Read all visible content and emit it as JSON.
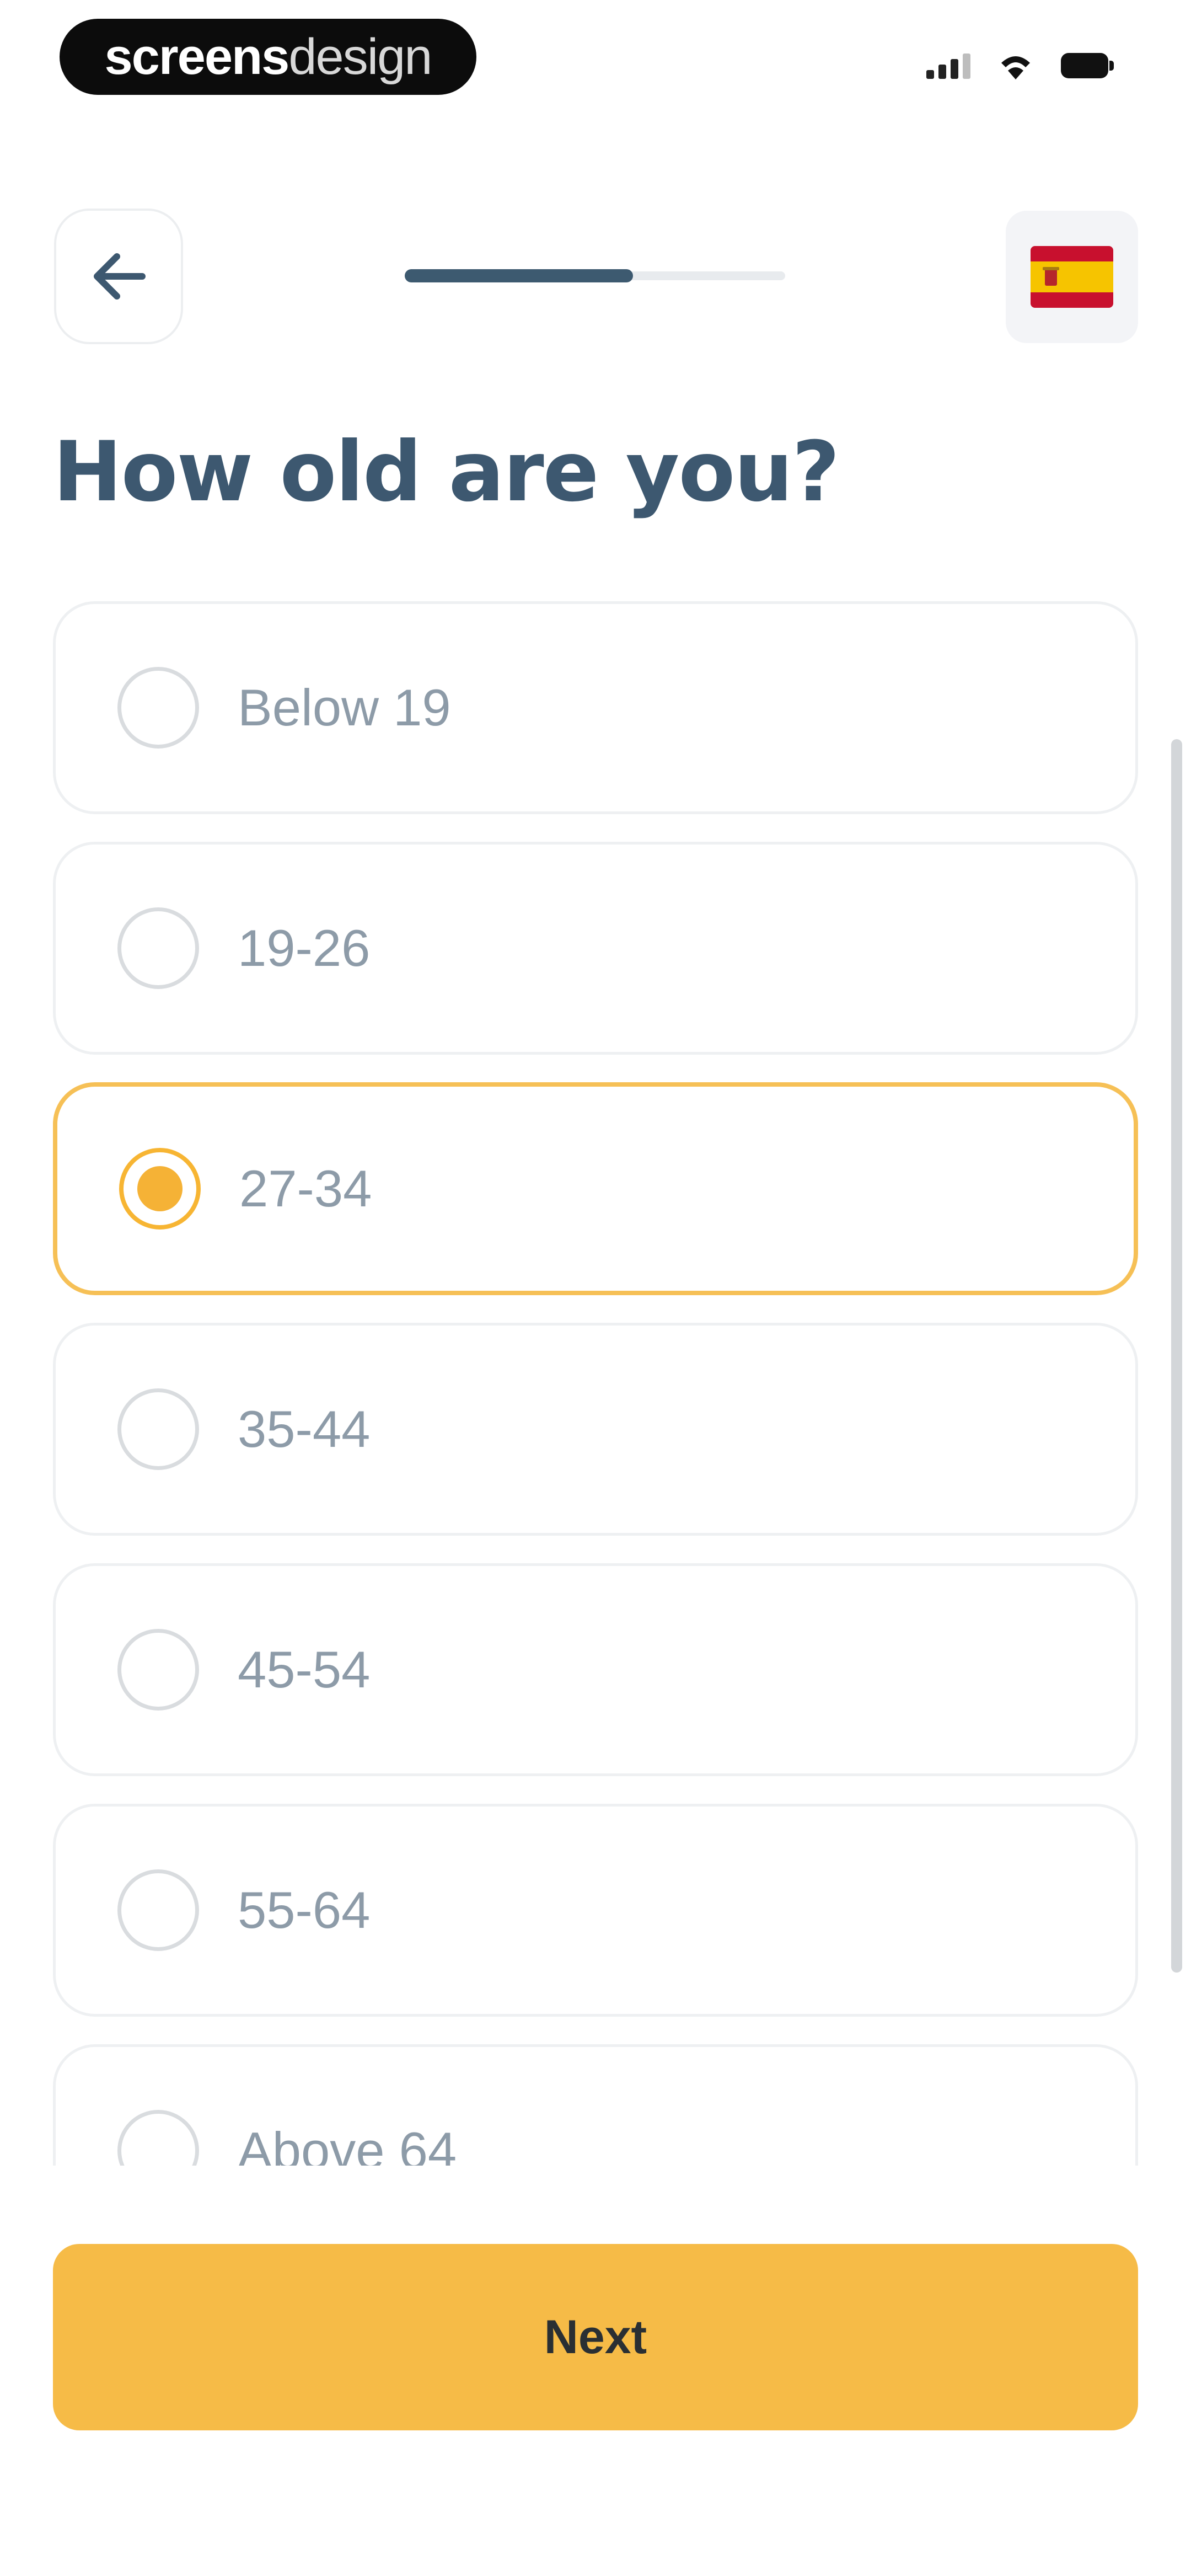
{
  "status_bar": {
    "brand_strong": "screens",
    "brand_light": "design"
  },
  "header": {
    "back_icon": "arrow-left-icon",
    "progress_value": 0.6,
    "language_flag": "spain-flag-icon"
  },
  "question": {
    "title": "How old are you?"
  },
  "options": [
    {
      "label": "Below 19",
      "selected": false
    },
    {
      "label": "19-26",
      "selected": false
    },
    {
      "label": "27-34",
      "selected": true
    },
    {
      "label": "35-44",
      "selected": false
    },
    {
      "label": "45-54",
      "selected": false
    },
    {
      "label": "55-64",
      "selected": false
    },
    {
      "label": "Above 64",
      "selected": false
    }
  ],
  "footer": {
    "next_label": "Next"
  },
  "colors": {
    "accent": "#f6bb47",
    "title": "#3d5870",
    "option_text": "#8d9ba8",
    "progress_fill": "#3d5a70"
  }
}
